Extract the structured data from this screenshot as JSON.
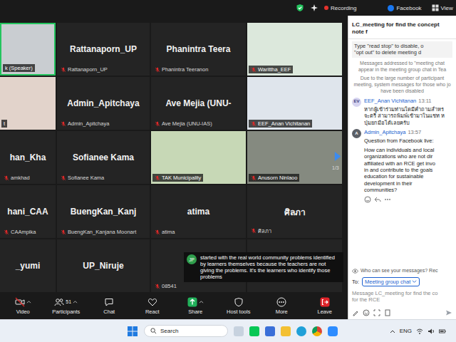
{
  "top_bar": {
    "recording": "Recording",
    "stream": "Facebook",
    "view": "View"
  },
  "gallery": {
    "page": "1/3",
    "tiles": [
      {
        "kind": "video",
        "label": "k (Speaker)",
        "muted": false,
        "speaking": true,
        "color": "#c9cdd1"
      },
      {
        "kind": "name",
        "title": "Rattanaporn_UP",
        "label": "Rattanaporn_UP",
        "muted": true,
        "speaking": false
      },
      {
        "kind": "name",
        "title": "Phanintra  Teera",
        "label": "Phanintra Teeranon",
        "muted": true,
        "speaking": false
      },
      {
        "kind": "video",
        "label": "Warittha_EEF",
        "muted": true,
        "speaking": false,
        "color": "#dce8dc"
      },
      {
        "kind": "video",
        "label": "t",
        "muted": false,
        "speaking": false,
        "color": "#e2d3cb"
      },
      {
        "kind": "name",
        "title": "Admin_Apitchaya",
        "label": "Admin_Apitchaya",
        "muted": true,
        "speaking": false
      },
      {
        "kind": "name",
        "title": "Ave Mejia (UNU-",
        "label": "Ave Mejia (UNU-IAS)",
        "muted": true,
        "speaking": false
      },
      {
        "kind": "video",
        "label": "EEF_Anan Vichitanan",
        "muted": true,
        "speaking": false,
        "color": "#dfe5ec"
      },
      {
        "kind": "name",
        "title": "han_Kha",
        "label": "amkhad",
        "muted": true,
        "speaking": false
      },
      {
        "kind": "name",
        "title": "Sofianee Kama",
        "label": "Sofianee Kama",
        "muted": true,
        "speaking": false
      },
      {
        "kind": "video",
        "label": "TAK Municipality",
        "muted": true,
        "speaking": false,
        "color": "#c7d8b6"
      },
      {
        "kind": "video",
        "label": "Anusorn Ninlaoo",
        "muted": true,
        "speaking": false,
        "color": "#858a80"
      },
      {
        "kind": "name",
        "title": "hani_CAA",
        "label": "CAAmpika",
        "muted": true,
        "speaking": false
      },
      {
        "kind": "name",
        "title": "BuengKan_Kanj",
        "label": "BuengKan_Kanjana Moonart",
        "muted": true,
        "speaking": false
      },
      {
        "kind": "name",
        "title": "atima",
        "label": "atima",
        "muted": true,
        "speaking": false
      },
      {
        "kind": "name",
        "title": "ศิลภา",
        "label": "ศิลภา",
        "muted": true,
        "speaking": false
      },
      {
        "kind": "name",
        "title": "_yumi",
        "muted": true,
        "speaking": false
      },
      {
        "kind": "name",
        "title": "UP_Niruje",
        "muted": true,
        "speaking": false
      },
      {
        "kind": "name",
        "label": "08541",
        "muted": true,
        "speaking": false
      },
      {
        "kind": "name",
        "muted": true,
        "speaking": false
      }
    ]
  },
  "caption": {
    "initials": "JP",
    "text": "started with the real world community problems identified by learners themselves because the teachers are not giving the problems. It's the learners who identify those problems"
  },
  "toolbar": [
    {
      "label": "Video",
      "kind": "video",
      "caret": true
    },
    {
      "label": "Participants",
      "kind": "participants",
      "count": "51",
      "caret": true
    },
    {
      "label": "Chat",
      "kind": "chat",
      "caret": false
    },
    {
      "label": "React",
      "kind": "react",
      "caret": false
    },
    {
      "label": "Share",
      "kind": "share",
      "caret": true
    },
    {
      "label": "Host tools",
      "kind": "host",
      "caret": false
    },
    {
      "label": "More",
      "kind": "more",
      "caret": false
    },
    {
      "label": "Leave",
      "kind": "leave",
      "caret": false
    }
  ],
  "chat": {
    "title": "LC_meeting for find the concept note f",
    "notice_lines": [
      "Type \"read stop\" to disable, o",
      "\"opt out\" to delete meeting d"
    ],
    "system": [
      [
        "Messages addressed to \"meeting chat",
        "appear in the meeting group chat in Tea"
      ],
      [
        "Due to the large number of participant",
        "meeting, system messages for those who jo",
        "have been disabled"
      ]
    ],
    "messages": [
      {
        "initials": "EV",
        "color": "#d6d4f0",
        "sender": "EEF_Anan Vichitanan",
        "time": "13:11",
        "paragraphs": [
          [
            "หากผู้เข้าร่วมท่านใดมีคำถามสำหร",
            "จะตรี สามารถพิมพ์เข้ามาในแชท ห",
            "ปุ่มยกมือได้เลยครับ"
          ]
        ]
      },
      {
        "initials": "A",
        "color": "#5b5f66",
        "sender": "Admin_Apitchaya",
        "time": "13:57",
        "paragraphs": [
          [
            "Question from Facebook live:"
          ],
          [
            "How can individuals and local",
            "organizations who are not dir",
            "affiliated with an RCE get invo",
            "in and contribute to the goals",
            "education for sustainable",
            "development in their",
            "communities?"
          ]
        ]
      }
    ],
    "privacy": "Who can see your messages? Rec",
    "to_label": "To:",
    "recipient": "Meeting group chat",
    "compose_lines": [
      "Message LC_meeting for find the co",
      "for the RCE"
    ]
  },
  "taskbar": {
    "search": "Search",
    "language": "ENG"
  }
}
